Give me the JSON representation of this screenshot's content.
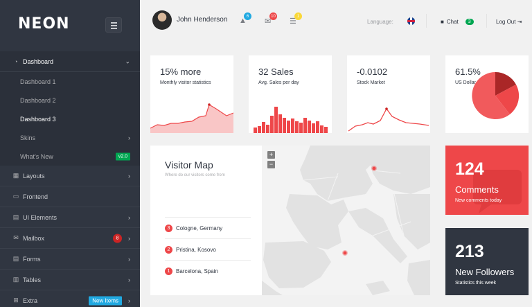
{
  "sidebar": {
    "logo": "NEON",
    "items": [
      {
        "icon": "dashboard-icon",
        "label": "Dashboard"
      },
      {
        "label": "Dashboard 1"
      },
      {
        "label": "Dashboard 2"
      },
      {
        "label": "Dashboard 3"
      },
      {
        "label": "Skins"
      },
      {
        "label": "What's New",
        "badge": "v2.0"
      },
      {
        "icon": "layouts-icon",
        "label": "Layouts"
      },
      {
        "icon": "monitor-icon",
        "label": "Frontend"
      },
      {
        "icon": "document-icon",
        "label": "UI Elements"
      },
      {
        "icon": "mail-icon",
        "label": "Mailbox",
        "badge": "8"
      },
      {
        "icon": "forms-icon",
        "label": "Forms"
      },
      {
        "icon": "table-icon",
        "label": "Tables"
      },
      {
        "icon": "basket-icon",
        "label": "Extra",
        "badge": "New Items"
      }
    ]
  },
  "header": {
    "username": "John Henderson",
    "notifications": {
      "alerts": "6",
      "messages": "10",
      "tasks": "1"
    },
    "language_label": "Language:",
    "chat_label": "Chat",
    "chat_count": "3",
    "logout_label": "Log Out"
  },
  "tiles": [
    {
      "value": "15% more",
      "label": "Monthly visitor statistics"
    },
    {
      "value": "32 Sales",
      "label": "Avg. Sales per day"
    },
    {
      "value": "-0.0102",
      "label": "Stock Market"
    },
    {
      "value": "61.5%",
      "label": "US Dollar Share"
    }
  ],
  "visitor_map": {
    "title": "Visitor Map",
    "subtitle": "Where do our visitors come from",
    "locations": [
      {
        "num": "3",
        "name": "Cologne, Germany"
      },
      {
        "num": "2",
        "name": "Pristina, Kosovo"
      },
      {
        "num": "1",
        "name": "Barcelona, Spain"
      }
    ],
    "zoom_in": "+",
    "zoom_out": "−"
  },
  "comments": {
    "value": "124",
    "label": "Comments",
    "sub": "New comments today"
  },
  "followers": {
    "value": "213",
    "label": "New Followers",
    "sub": "Statistics this week"
  },
  "colors": {
    "accent_red": "#ee4749",
    "sidebar": "#303641",
    "green": "#00a651",
    "blue": "#21a9e1"
  }
}
